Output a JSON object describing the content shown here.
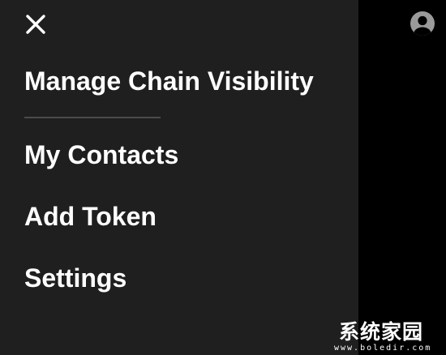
{
  "drawer": {
    "close_icon": "close-icon",
    "items": [
      {
        "label": "Manage Chain Visibility"
      },
      {
        "label": "My Contacts"
      },
      {
        "label": "Add Token"
      },
      {
        "label": "Settings"
      }
    ]
  },
  "header": {
    "avatar_icon": "user-avatar-icon"
  },
  "watermark": {
    "text_cn": "系统家园",
    "url": "www.boledir.com"
  },
  "colors": {
    "drawer_bg": "#1f1f20",
    "backdrop": "#000000",
    "text": "#ffffff",
    "divider": "#4a4a4c",
    "avatar": "#9a9a9a"
  }
}
